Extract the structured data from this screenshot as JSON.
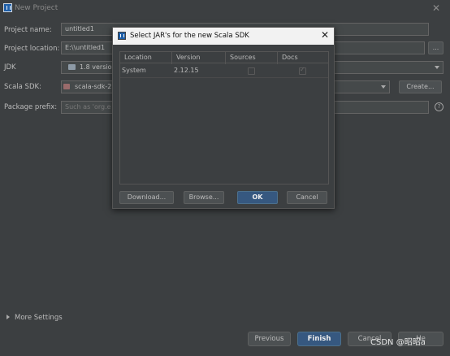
{
  "window": {
    "title": "New Project",
    "close_glyph": "✕"
  },
  "form": {
    "project_name": {
      "label": "Project name:",
      "value": "untitled1"
    },
    "project_location": {
      "label": "Project location:",
      "value": "E:\\\\untitled1",
      "browse_label": "..."
    },
    "jdk": {
      "label": "JDK",
      "value": "1.8 version"
    },
    "scala_sdk": {
      "label": "Scala SDK:",
      "value": "scala-sdk-2",
      "create_label": "Create..."
    },
    "package_prefix": {
      "label": "Package prefix:",
      "placeholder": "Such as 'org.e"
    },
    "help_glyph": "?"
  },
  "more_settings": {
    "label": "More Settings"
  },
  "footer": {
    "previous_label": "Previous",
    "finish_label": "Finish",
    "cancel_label": "Cancel",
    "fourth_label": "He"
  },
  "watermark": {
    "text": "CSDN @昭昭a"
  },
  "modal": {
    "title": "Select JAR's for the new Scala SDK",
    "close_glyph": "✕",
    "columns": [
      "Location",
      "Version",
      "Sources",
      "Docs"
    ],
    "rows": [
      {
        "location": "System",
        "version": "2.12.15",
        "sources": false,
        "docs": true
      }
    ],
    "buttons": {
      "download": "Download...",
      "browse": "Browse...",
      "ok": "OK",
      "cancel": "Cancel"
    }
  },
  "colors": {
    "background": "#3c3f41",
    "field": "#45494a",
    "primary_button": "#365880",
    "modal_titlebar": "#f2f2f2"
  },
  "icons": [
    "intellij-app-icon",
    "close-icon",
    "folder-icon",
    "dropdown-arrow-icon",
    "help-icon",
    "expand-triangle-icon",
    "checkbox-icon"
  ]
}
